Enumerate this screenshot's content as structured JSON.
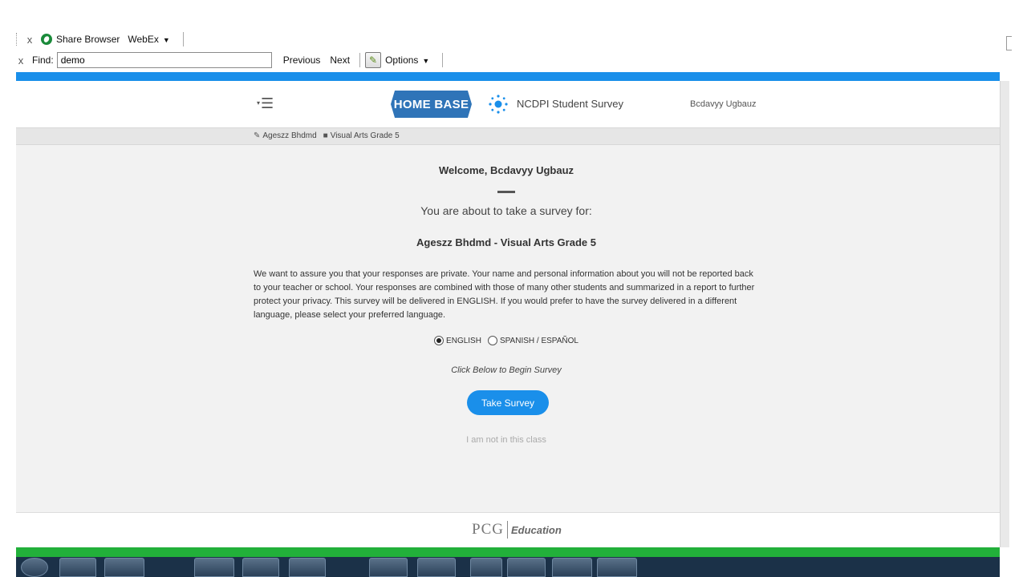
{
  "browser_toolbar": {
    "share_browser": "Share Browser",
    "webex": "WebEx",
    "find_label": "Find:",
    "find_value": "demo",
    "previous": "Previous",
    "next": "Next",
    "options": "Options",
    "close_glyph": "x"
  },
  "header": {
    "logo": "HOME BASE",
    "survey_title": "NCDPI Student Survey",
    "user_name": "Bcdavyy Ugbauz",
    "menu_glyph": "☰",
    "menu_caret": "▾"
  },
  "breadcrumb": {
    "items": [
      {
        "label": "Ageszz Bhdmd",
        "icon": "edit-icon"
      },
      {
        "label": "Visual Arts Grade 5",
        "icon": "book-icon"
      }
    ]
  },
  "main": {
    "welcome": "Welcome, Bcdavyy Ugbauz",
    "about": "You are about to take a survey for:",
    "class_name": "Ageszz Bhdmd - Visual Arts Grade 5",
    "privacy_text": "We want to assure you that your responses are private. Your name and personal information about you will not be reported back to your teacher or school. Your responses are combined with those of many other students and summarized in a report to further protect your privacy. This survey will be delivered in ENGLISH. If you would prefer to have the survey delivered in a different language, please select your preferred language.",
    "languages": [
      {
        "label": "ENGLISH",
        "selected": true
      },
      {
        "label": "SPANISH / ESPAÑOL",
        "selected": false
      }
    ],
    "click_below": "Click Below to Begin Survey",
    "take_survey": "Take Survey",
    "not_in_class": "I am not in this class"
  },
  "footer": {
    "pcg": "PCG",
    "education": "Education"
  },
  "colors": {
    "accent": "#1a8fea",
    "logo_blue": "#2f74b8",
    "taskbar_green": "#22b03a"
  }
}
